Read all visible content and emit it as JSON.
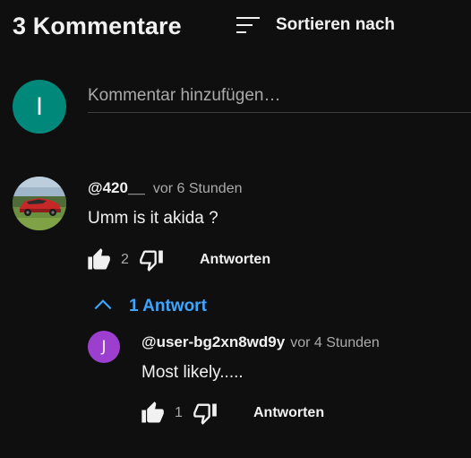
{
  "header": {
    "count_title": "3 Kommentare",
    "sort_label": "Sortieren nach"
  },
  "add_comment": {
    "avatar_letter": "I",
    "avatar_color": "#00897b",
    "placeholder": "Kommentar hinzufügen…"
  },
  "comments": [
    {
      "author": "@420__",
      "timestamp": "vor 6 Stunden",
      "text": "Umm is it akida ?",
      "like_count": "2",
      "reply_label": "Antworten",
      "replies_toggle": "1 Antwort"
    }
  ],
  "replies": [
    {
      "avatar_letter": "J",
      "avatar_color": "#9c3fcf",
      "author": "@user-bg2xn8wd9y",
      "timestamp": "vor 4 Stunden",
      "text": "Most likely.....",
      "like_count": "1",
      "reply_label": "Antworten"
    }
  ],
  "colors": {
    "background": "#0f0f0f",
    "text": "#f1f1f1",
    "secondary_text": "#aaaaaa",
    "link": "#3ea6ff"
  }
}
